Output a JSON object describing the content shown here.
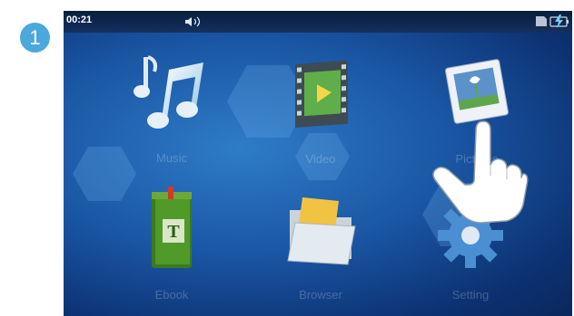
{
  "step": {
    "number": "1"
  },
  "status_bar": {
    "time": "00:21"
  },
  "menu": {
    "items": [
      {
        "label": "Music",
        "icon": "music-notes-icon"
      },
      {
        "label": "Video",
        "icon": "film-strip-icon"
      },
      {
        "label": "Pictures",
        "icon": "photo-icon"
      },
      {
        "label": "Ebook",
        "icon": "book-icon"
      },
      {
        "label": "Browser",
        "icon": "folder-icon"
      },
      {
        "label": "Setting",
        "icon": "gear-icon"
      }
    ]
  },
  "colors": {
    "badge": "#4aa8dc",
    "background": "#1a56a4"
  }
}
